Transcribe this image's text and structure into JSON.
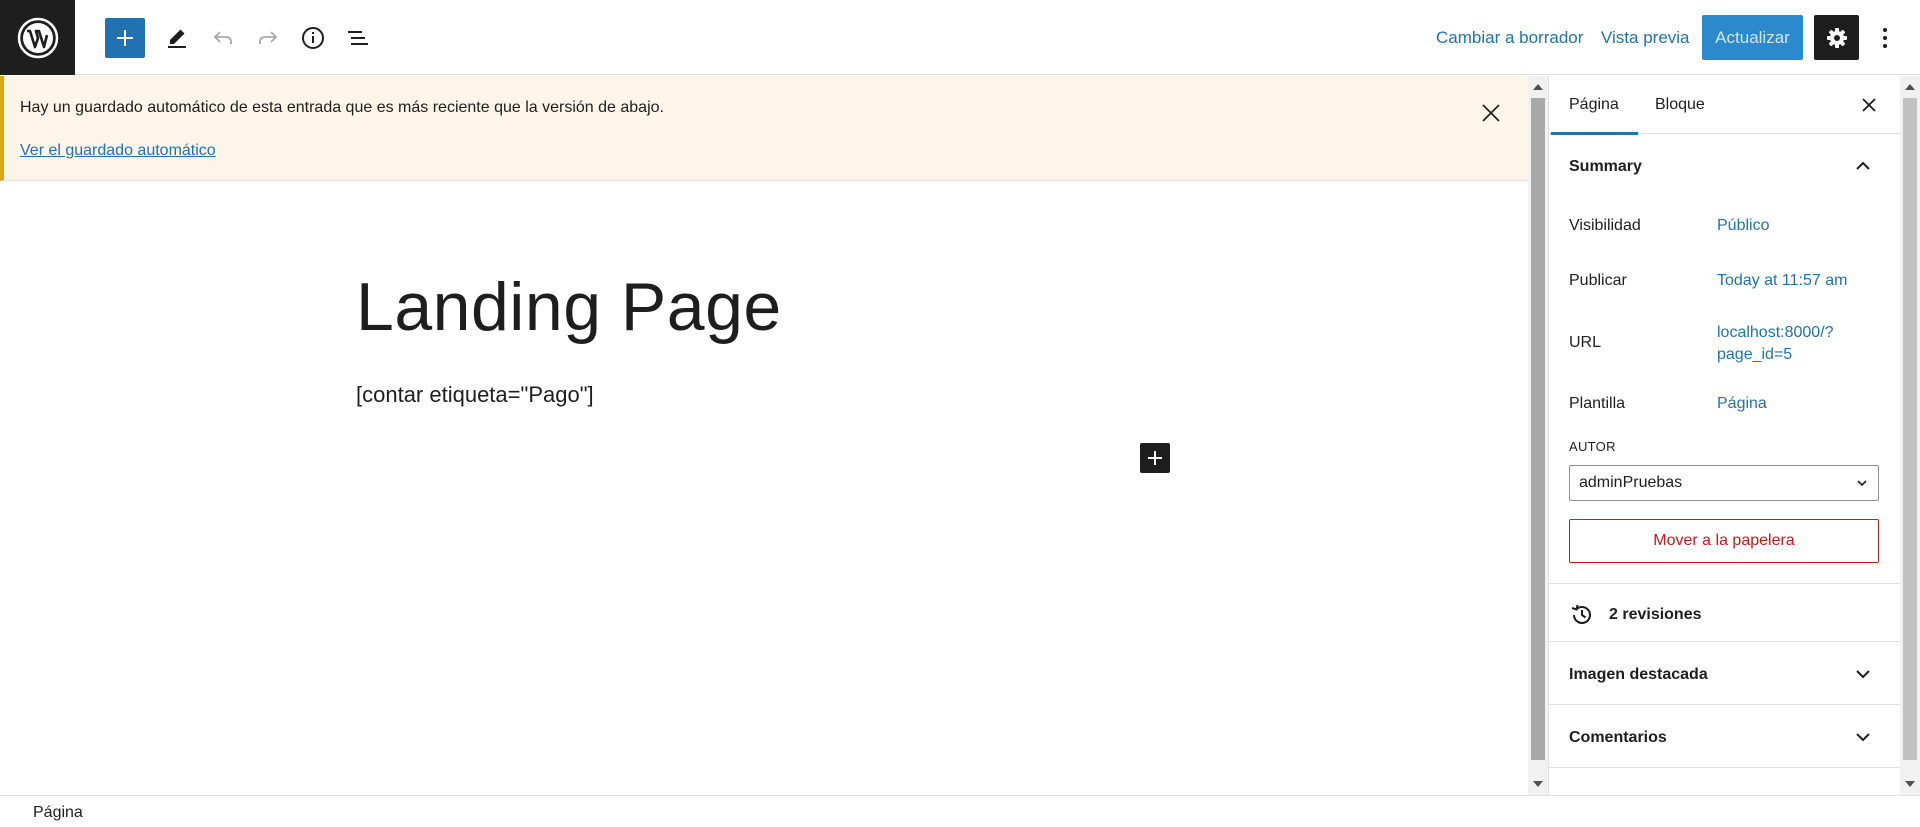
{
  "header": {
    "logo_icon": "wordpress-logo",
    "add_block_icon": "plus-icon",
    "tools_icon": "pencil-icon",
    "undo_icon": "undo-icon",
    "redo_icon": "redo-icon",
    "details_icon": "info-icon",
    "list_view_icon": "list-view-icon",
    "switch_to_draft": "Cambiar a borrador",
    "preview": "Vista previa",
    "update": "Actualizar",
    "settings_icon": "gear-icon",
    "more_icon": "more-vertical-icon"
  },
  "notice": {
    "message": "Hay un guardado automático de esta entrada que es más reciente que la versión de abajo.",
    "link": "Ver el guardado automático",
    "close_icon": "close-icon"
  },
  "editor": {
    "title": "Landing Page",
    "shortcode": "[contar etiqueta=\"Pago\"]",
    "add_block_icon": "plus-icon"
  },
  "sidebar": {
    "tabs": [
      {
        "label": "Página",
        "active": true
      },
      {
        "label": "Bloque",
        "active": false
      }
    ],
    "summary": {
      "title": "Summary",
      "rows": [
        {
          "label": "Visibilidad",
          "value": "Público"
        },
        {
          "label": "Publicar",
          "value": "Today at 11:57 am"
        },
        {
          "label": "URL",
          "value_line1": "localhost:8000/?",
          "value_line2": "page_id=5"
        },
        {
          "label": "Plantilla",
          "value": "Página"
        }
      ],
      "author_label": "AUTOR",
      "author_value": "adminPruebas",
      "trash": "Mover a la papelera"
    },
    "revisions": "2 revisiones",
    "panels": [
      {
        "title": "Imagen destacada"
      },
      {
        "title": "Comentarios"
      }
    ]
  },
  "footer": {
    "breadcrumb": "Página"
  },
  "colors": {
    "accent": "#2271b1",
    "update_button": "#2b8acb",
    "notice_border": "#dba617",
    "danger": "#cc1818",
    "dark": "#1e1e1e"
  }
}
